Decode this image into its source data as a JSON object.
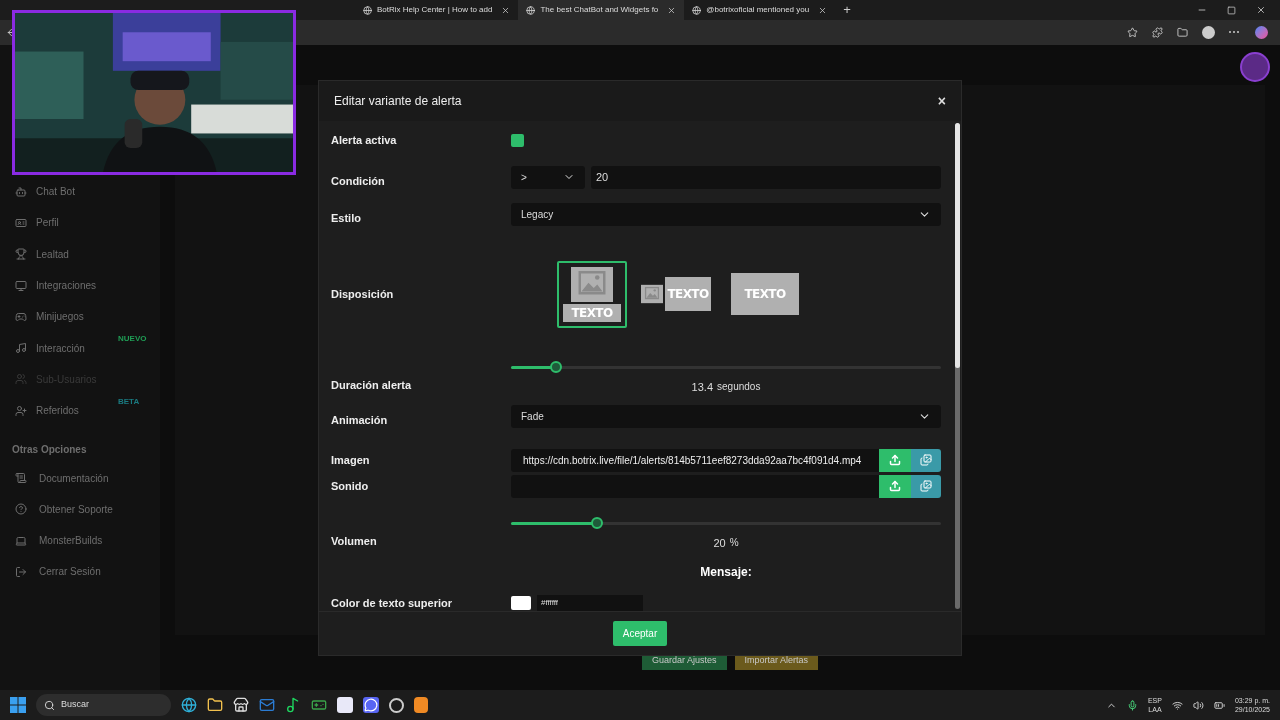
{
  "browser": {
    "tabs": [
      {
        "title": "BotRix Help Center | How to add",
        "selected": false
      },
      {
        "title": "The best ChatBot and Widgets fo",
        "selected": true
      },
      {
        "title": "@botrixoficial mentioned you",
        "selected": false
      }
    ],
    "new_tab": "+"
  },
  "sidebar": {
    "items": [
      {
        "label": "Chat Bot",
        "disabled": false
      },
      {
        "label": "Perfil",
        "disabled": false
      },
      {
        "label": "Lealtad",
        "disabled": false
      },
      {
        "label": "Integraciones",
        "disabled": false
      },
      {
        "label": "Minijuegos",
        "disabled": false
      },
      {
        "label": "Interacción",
        "disabled": false,
        "badge": "NUEVO",
        "color": "#1f9d55"
      },
      {
        "label": "Sub-Usuarios",
        "disabled": true
      },
      {
        "label": "Referidos",
        "disabled": false,
        "badge": "BETA",
        "color": "#1a7a80"
      }
    ],
    "section_title": "Otras Opciones",
    "other_items": [
      {
        "label": "Documentación"
      },
      {
        "label": "Obtener Soporte"
      },
      {
        "label": "MonsterBuilds"
      },
      {
        "label": "Cerrar Sesión"
      }
    ]
  },
  "page_buttons": [
    {
      "label": "Guardar Ajustes",
      "color": "#1e5c36"
    },
    {
      "label": "Importar Alertas",
      "color": "#6b5a1c"
    }
  ],
  "modal": {
    "title": "Editar variante de alerta",
    "close": "×",
    "fields": [
      {
        "kind": "checkbox",
        "label": "Alerta activa",
        "checked": true
      },
      {
        "kind": "condition",
        "label": "Condición",
        "operator": ">",
        "value": "20"
      },
      {
        "kind": "select",
        "label": "Estilo",
        "value": "Legacy"
      },
      {
        "kind": "layout",
        "label": "Disposición",
        "options": [
          {
            "text": "TEXTO",
            "selected": true
          },
          {
            "text": "TEXTO",
            "selected": false
          },
          {
            "text": "TEXTO",
            "selected": false
          }
        ]
      },
      {
        "kind": "slider",
        "label": "Duración alerta",
        "level": 0.105,
        "value": "13.4",
        "unit": "segundos"
      },
      {
        "kind": "select",
        "label": "Animación",
        "value": "Fade"
      },
      {
        "kind": "file",
        "label": "Imagen",
        "value": "https://cdn.botrix.live/file/1/alerts/814b5711eef8273dda92aa7bc4f091d4.mp4"
      },
      {
        "kind": "file",
        "label": "Sonido"
      },
      {
        "kind": "slider",
        "label": "Volumen",
        "level": 0.2,
        "value": "20",
        "unit": "%"
      },
      {
        "kind": "heading",
        "label": "Mensaje:"
      },
      {
        "kind": "color",
        "label": "Color de texto superior",
        "value": "#ffffff",
        "color": "#ffffff"
      }
    ],
    "accept": "Aceptar"
  },
  "taskbar": {
    "search": "Buscar",
    "language": "ESP",
    "layout": "LAA",
    "time": "03:29 p. m.",
    "date": "29/10/2025"
  }
}
